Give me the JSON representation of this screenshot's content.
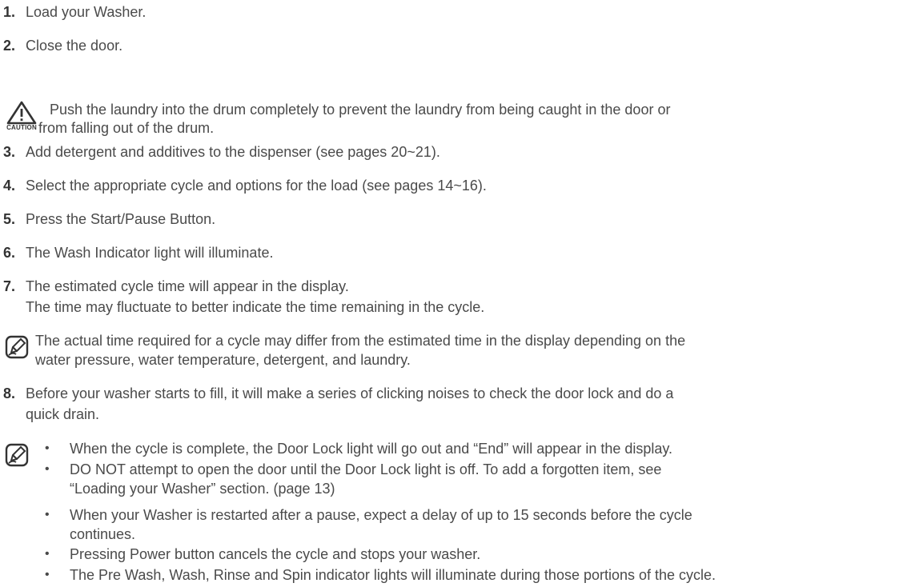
{
  "steps": [
    {
      "num": "1.",
      "text": "Load your Washer."
    },
    {
      "num": "2.",
      "text": "Close the door."
    },
    {
      "num": "3.",
      "text": "Add detergent and additives to the dispenser (see pages 20~21)."
    },
    {
      "num": "4.",
      "text": "Select the appropriate cycle and options for the load (see pages 14~16)."
    },
    {
      "num": "5.",
      "text": "Press the Start/Pause Button."
    },
    {
      "num": "6.",
      "text": "The Wash Indicator light will illuminate."
    },
    {
      "num": "7.",
      "text": "The estimated cycle time will appear in the display.",
      "text2": "The time may fluctuate to better indicate the time remaining in the cycle."
    },
    {
      "num": "8.",
      "text": "Before your washer starts to fill, it will make a series of clicking noises to check the door lock and do a",
      "text2": "quick drain."
    }
  ],
  "caution": {
    "label": "CAUTION",
    "line1": "Push the laundry into the drum completely to prevent the laundry from being caught in the door or",
    "line2": "from falling out of the drum."
  },
  "note1": {
    "line1": "The actual time required for a cycle may differ from the estimated time in the display depending on the",
    "line2": "water pressure, water temperature, detergent, and laundry."
  },
  "bullets": [
    {
      "line1": "When the cycle is complete, the Door Lock light will go out and “End” will appear in the display."
    },
    {
      "line1": "DO NOT attempt to open the door until the Door Lock light is off. To add a forgotten item, see",
      "line2": "“Loading your Washer” section. (page 13)"
    },
    {
      "line1": "When your Washer is restarted after a pause, expect a delay of up to 15 seconds before the cycle",
      "line2": "continues."
    },
    {
      "line1": "Pressing Power button cancels the cycle and stops your washer."
    },
    {
      "line1": "The Pre Wash, Wash, Rinse and Spin indicator lights will illuminate during those portions of the cycle."
    }
  ],
  "bullet_glyph": "•",
  "icons": {
    "caution": "caution-triangle-icon",
    "note": "note-pencil-icon"
  }
}
